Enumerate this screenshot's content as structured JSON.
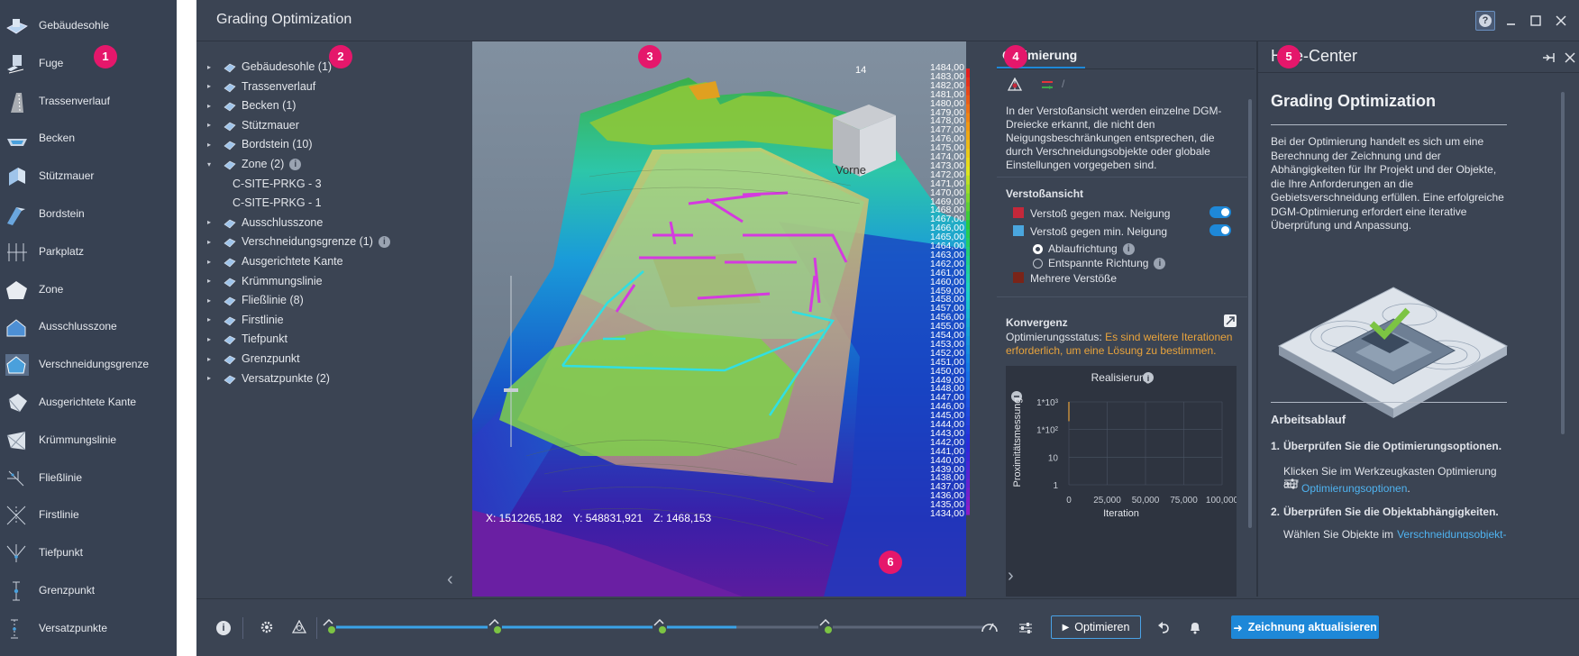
{
  "window": {
    "title": "Grading Optimization",
    "help_glyph": "?"
  },
  "badges": [
    "1",
    "2",
    "3",
    "4",
    "5",
    "6"
  ],
  "toolbox": {
    "items": [
      {
        "label": "Gebäudesohle",
        "icon": "building-pad-icon"
      },
      {
        "label": "Fuge",
        "icon": "joint-icon"
      },
      {
        "label": "Trassenverlauf",
        "icon": "alignment-icon"
      },
      {
        "label": "Becken",
        "icon": "basin-icon"
      },
      {
        "label": "Stützmauer",
        "icon": "retaining-wall-icon"
      },
      {
        "label": "Bordstein",
        "icon": "curb-icon"
      },
      {
        "label": "Parkplatz",
        "icon": "parking-icon"
      },
      {
        "label": "Zone",
        "icon": "zone-icon"
      },
      {
        "label": "Ausschlusszone",
        "icon": "exclusion-zone-icon"
      },
      {
        "label": "Verschneidungsgrenze",
        "icon": "grading-limit-icon"
      },
      {
        "label": "Ausgerichtete Kante",
        "icon": "aligned-edge-icon"
      },
      {
        "label": "Krümmungslinie",
        "icon": "crease-line-icon"
      },
      {
        "label": "Fließlinie",
        "icon": "flow-line-icon"
      },
      {
        "label": "Firstlinie",
        "icon": "ridge-line-icon"
      },
      {
        "label": "Tiefpunkt",
        "icon": "low-point-icon"
      },
      {
        "label": "Grenzpunkt",
        "icon": "boundary-point-icon"
      },
      {
        "label": "Versatzpunkte",
        "icon": "offset-points-icon"
      }
    ]
  },
  "tree": {
    "items": [
      {
        "label": "Gebäudesohle (1)",
        "caret": "▸",
        "indent": 0
      },
      {
        "label": "Trassenverlauf",
        "caret": "▸",
        "indent": 0
      },
      {
        "label": "Becken (1)",
        "caret": "▸",
        "indent": 0
      },
      {
        "label": "Stützmauer",
        "caret": "▸",
        "indent": 0
      },
      {
        "label": "Bordstein (10)",
        "caret": "▸",
        "indent": 0
      },
      {
        "label": "Zone (2)",
        "caret": "▾",
        "indent": 0,
        "info": true
      },
      {
        "label": "C-SITE-PRKG - 3",
        "caret": "",
        "indent": 1
      },
      {
        "label": "C-SITE-PRKG - 1",
        "caret": "",
        "indent": 1
      },
      {
        "label": "Ausschlusszone",
        "caret": "▸",
        "indent": 0
      },
      {
        "label": "Verschneidungsgrenze (1)",
        "caret": "▸",
        "indent": 0,
        "info": true
      },
      {
        "label": "Ausgerichtete Kante",
        "caret": "▸",
        "indent": 0
      },
      {
        "label": "Krümmungslinie",
        "caret": "▸",
        "indent": 0
      },
      {
        "label": "Fließlinie (8)",
        "caret": "▸",
        "indent": 0
      },
      {
        "label": "Firstlinie",
        "caret": "▸",
        "indent": 0
      },
      {
        "label": "Tiefpunkt",
        "caret": "▸",
        "indent": 0
      },
      {
        "label": "Grenzpunkt",
        "caret": "▸",
        "indent": 0
      },
      {
        "label": "Versatzpunkte (2)",
        "caret": "▸",
        "indent": 0
      }
    ]
  },
  "viewport": {
    "coords": {
      "x": "X: 1512265,182",
      "y": "Y: 548831,921",
      "z": "Z: 1468,153"
    },
    "viewcube_label": "Vorne",
    "corner_text": "14",
    "nav_left": "‹"
  },
  "legend": {
    "values": [
      "1484,00",
      "1483,00",
      "1482,00",
      "1481,00",
      "1480,00",
      "1479,00",
      "1478,00",
      "1477,00",
      "1476,00",
      "1475,00",
      "1474,00",
      "1473,00",
      "1472,00",
      "1471,00",
      "1470,00",
      "1469,00",
      "1468,00",
      "1467,00",
      "1466,00",
      "1465,00",
      "1464,00",
      "1463,00",
      "1462,00",
      "1461,00",
      "1460,00",
      "1459,00",
      "1458,00",
      "1457,00",
      "1456,00",
      "1455,00",
      "1454,00",
      "1453,00",
      "1452,00",
      "1451,00",
      "1450,00",
      "1449,00",
      "1448,00",
      "1447,00",
      "1446,00",
      "1445,00",
      "1444,00",
      "1443,00",
      "1442,00",
      "1441,00",
      "1440,00",
      "1439,00",
      "1438,00",
      "1437,00",
      "1436,00",
      "1435,00",
      "1434,00"
    ]
  },
  "optimization": {
    "tab_title": "Optimierung",
    "description": "In der Verstoßansicht werden einzelne DGM-Dreiecke erkannt, die nicht den Neigungsbeschränkungen entsprechen, die durch Verschneidungsobjekte oder globale Einstellungen vorgegeben sind.",
    "violation_section": "Verstoßansicht",
    "violations": [
      {
        "label": "Verstoß gegen max. Neigung",
        "color": "#c4283a",
        "toggle": true
      },
      {
        "label": "Verstoß gegen min. Neigung",
        "color": "#4aa6de",
        "toggle": true
      }
    ],
    "radio_options": [
      {
        "label": "Ablaufrichtung",
        "selected": true
      },
      {
        "label": "Entspannte Richtung",
        "selected": false
      }
    ],
    "multiple": {
      "label": "Mehrere Verstöße",
      "color": "#7a2418"
    },
    "convergence_title": "Konvergenz",
    "status_label": "Optimierungsstatus:",
    "status_value": "Es sind weitere Iterationen erforderlich, um eine Lösung zu bestimmen.",
    "status_color": "#e8a33c",
    "nav_right": "›"
  },
  "chart_data": {
    "type": "line",
    "title": "Realisierung",
    "ylabel": "Proximitätsmessung",
    "xlabel": "Iteration",
    "y_scale": "log",
    "y_ticks": [
      "1",
      "10",
      "1*10²",
      "1*10³"
    ],
    "x_ticks": [
      "0",
      "25,000",
      "50,000",
      "75,000",
      "100,000"
    ],
    "xlim": [
      0,
      100000
    ],
    "ylim": [
      1,
      1000
    ],
    "series": [
      {
        "x": [
          0,
          0
        ],
        "y": [
          200,
          1000
        ]
      }
    ]
  },
  "help": {
    "panel_title": "Hilfe-Center",
    "heading": "Grading Optimization",
    "intro": "Bei der Optimierung handelt es sich um eine Berechnung der Zeichnung und der Abhängigkeiten für Ihr Projekt und der Objekte, die Ihre Anforderungen an die Gebietsverschneidung erfüllen. Eine erfolgreiche DGM-Optimierung erfordert eine iterative Überprüfung und Anpassung.",
    "workflow_title": "Arbeitsablauf",
    "steps": [
      {
        "num": "1.",
        "title": "Überprüfen Sie die Optimierungsoptionen.",
        "text": "Klicken Sie im Werkzeugkasten Optimierung auf",
        "link": "Optimierungsoptionen",
        "end": "."
      },
      {
        "num": "2.",
        "title": "Überprüfen Sie die Objektabhängigkeiten.",
        "text": "Wählen Sie Objekte im",
        "link": "Verschneidungsobjekt-"
      }
    ]
  },
  "bottom": {
    "optimize_label": "Optimieren",
    "update_label": "Zeichnung aktualisieren",
    "progress": 0.62
  },
  "colors": {
    "accent": "#1e88d8",
    "badge": "#e5176b",
    "panel": "#3b4453",
    "toolbox": "#374152"
  }
}
